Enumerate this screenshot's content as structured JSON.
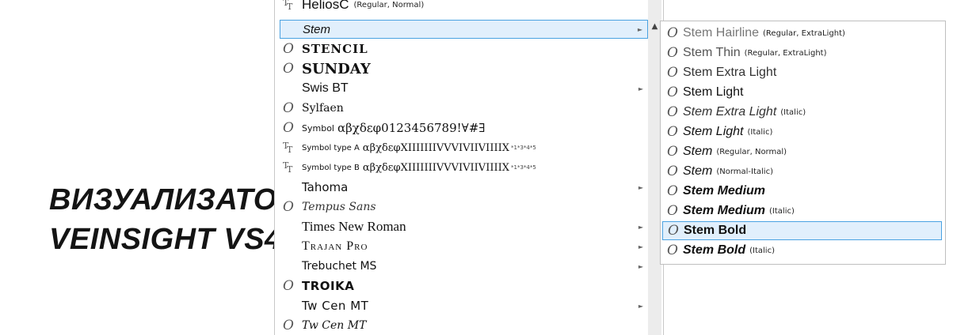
{
  "background": {
    "headline_line1": "ВИЗУАЛИЗАТО",
    "headline_line2": "VEINSIGHT VS4"
  },
  "font_list": [
    {
      "name": "HeliosC",
      "desc": "(Regular, Normal)",
      "icon": "truetype-icon"
    },
    {
      "name": "Stem",
      "icon": "none",
      "submenu": true,
      "selected": true
    },
    {
      "name": "STENCIL",
      "icon": "opentype-icon"
    },
    {
      "name": "SUNDAY",
      "icon": "opentype-icon"
    },
    {
      "name": "Swis BT",
      "icon": "none",
      "submenu": true
    },
    {
      "name": "Sylfaen",
      "icon": "opentype-icon"
    },
    {
      "name": "Symbol",
      "sample": "αβχδεφ0123456789!∀#∃",
      "icon": "opentype-icon"
    },
    {
      "name": "Symbol type A",
      "sample": "αβχδεφXIIIIIIIVVVIVIIVIIIIX",
      "sup": "*1*3*4*5",
      "icon": "truetype-icon"
    },
    {
      "name": "Symbol type B",
      "sample": "αβχδεφXIIIIIIIVVVIVIIVIIIIX",
      "sup": "*1*3*4*5",
      "icon": "truetype-icon"
    },
    {
      "name": "Tahoma",
      "icon": "none",
      "submenu": true
    },
    {
      "name": "Tempus Sans",
      "icon": "opentype-icon"
    },
    {
      "name": "Times New Roman",
      "icon": "none",
      "submenu": true
    },
    {
      "name": "Trajan Pro",
      "icon": "none",
      "submenu": true
    },
    {
      "name": "Trebuchet MS",
      "icon": "none",
      "submenu": true
    },
    {
      "name": "TROIKA",
      "icon": "opentype-icon"
    },
    {
      "name": "Tw Cen MT",
      "icon": "none",
      "submenu": true
    },
    {
      "name": "Tw Cen MT",
      "icon": "opentype-icon"
    }
  ],
  "stem_submenu": [
    {
      "name": "Stem Hairline",
      "desc": "(Regular, ExtraLight)"
    },
    {
      "name": "Stem Thin",
      "desc": "(Regular, ExtraLight)"
    },
    {
      "name": "Stem Extra Light",
      "desc": ""
    },
    {
      "name": "Stem Light",
      "desc": ""
    },
    {
      "name": "Stem Extra Light",
      "desc": "(Italic)"
    },
    {
      "name": "Stem Light",
      "desc": "(Italic)"
    },
    {
      "name": "Stem",
      "desc": "(Regular, Normal)"
    },
    {
      "name": "Stem",
      "desc": "(Normal-Italic)"
    },
    {
      "name": "Stem Medium",
      "desc": ""
    },
    {
      "name": "Stem Medium",
      "desc": "(Italic)"
    },
    {
      "name": "Stem Bold",
      "desc": "",
      "selected": true
    },
    {
      "name": "Stem Bold",
      "desc": "(Italic)"
    }
  ],
  "scroll_up_arrow": "▲",
  "submenu_arrow": "►",
  "colors": {
    "highlight_bg": "#e1effc",
    "highlight_border": "#4aa2e2"
  }
}
